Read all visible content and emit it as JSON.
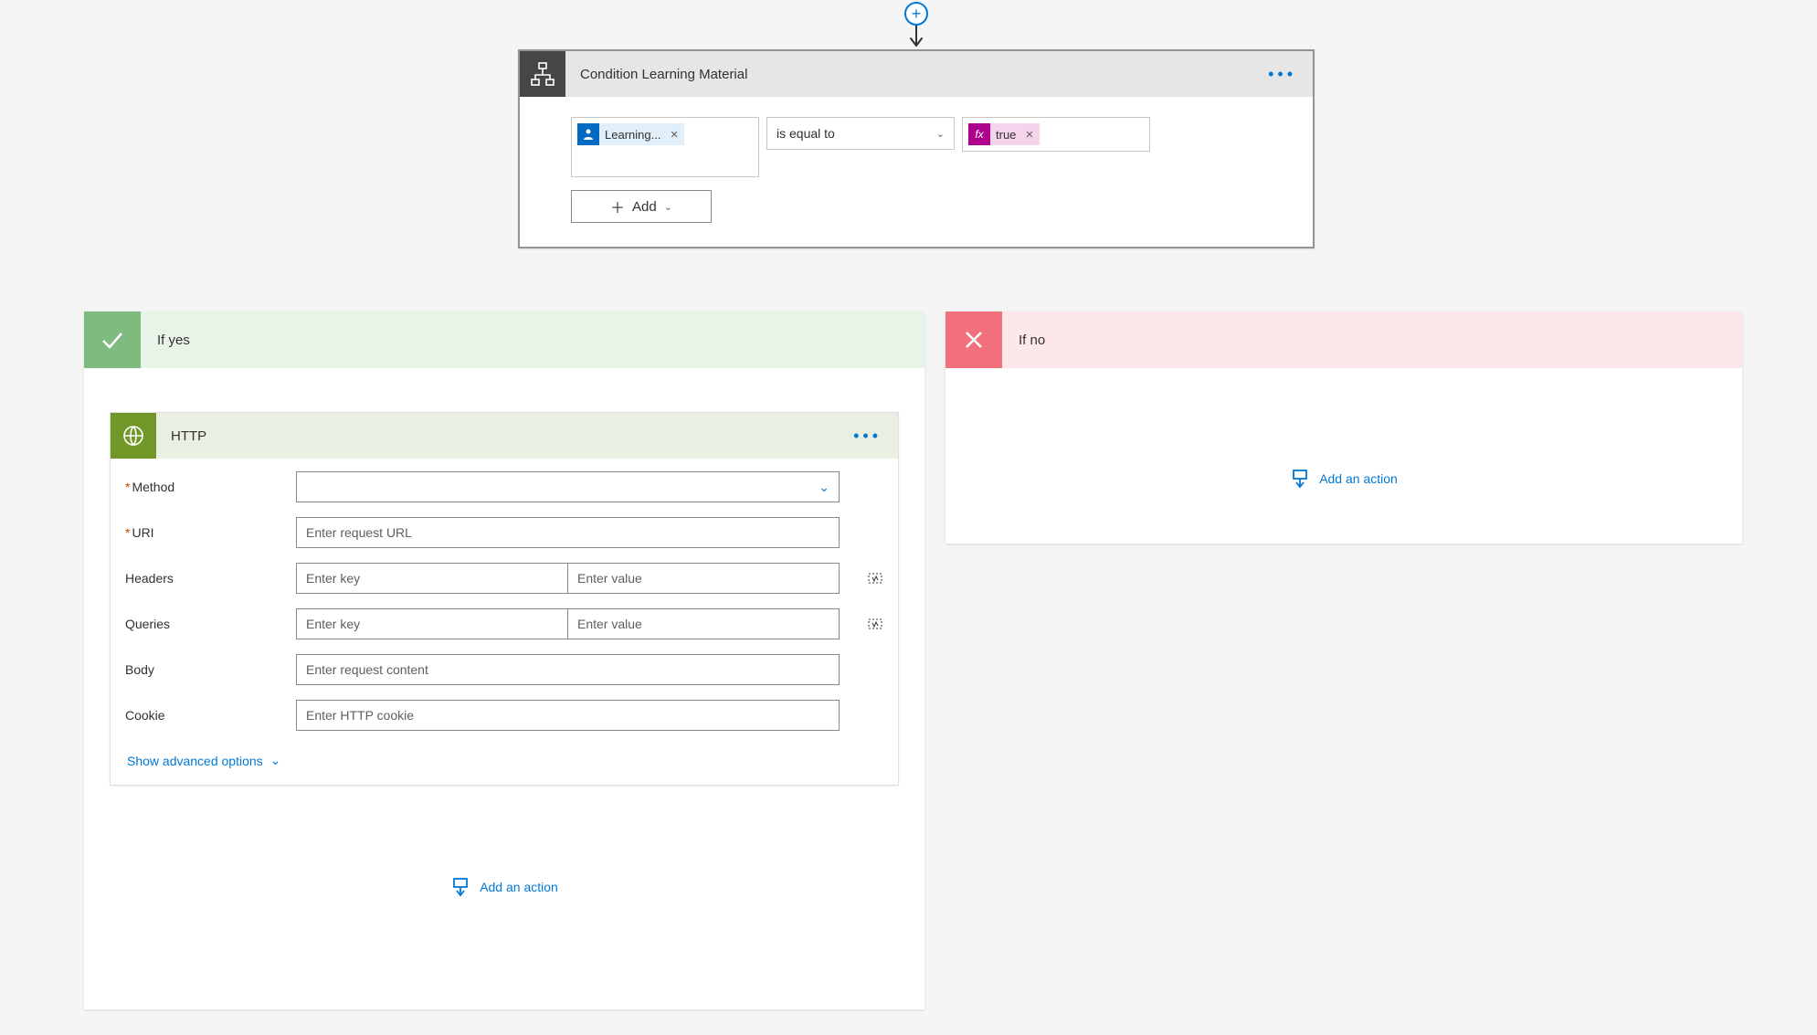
{
  "condition": {
    "title": "Condition Learning Material",
    "left_token_label": "Learning...",
    "operator": "is equal to",
    "right_token_label": "true",
    "add_label": "Add"
  },
  "branches": {
    "yes_label": "If yes",
    "no_label": "If no"
  },
  "http_action": {
    "title": "HTTP",
    "fields": {
      "method_label": "Method",
      "uri_label": "URI",
      "uri_placeholder": "Enter request URL",
      "headers_label": "Headers",
      "key_placeholder": "Enter key",
      "value_placeholder": "Enter value",
      "queries_label": "Queries",
      "body_label": "Body",
      "body_placeholder": "Enter request content",
      "cookie_label": "Cookie",
      "cookie_placeholder": "Enter HTTP cookie"
    },
    "advanced_label": "Show advanced options"
  },
  "add_action_label": "Add an action"
}
